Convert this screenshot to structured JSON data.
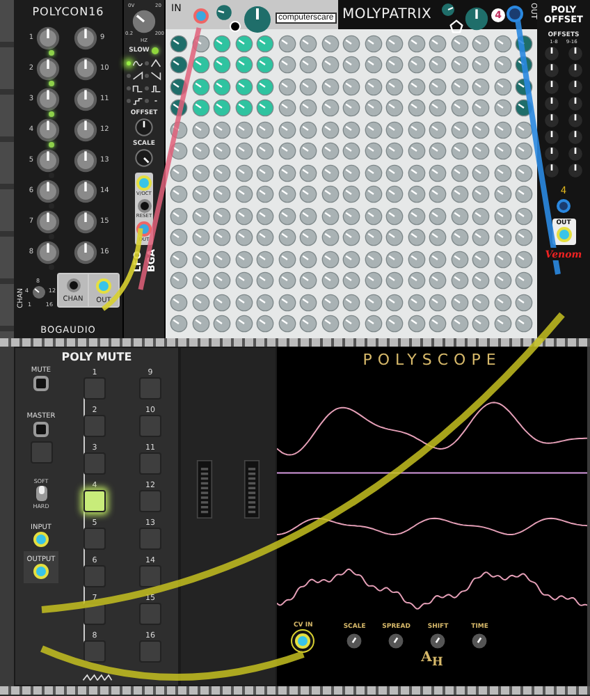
{
  "polycon16": {
    "title": "POLYCON16",
    "knobs": [
      {
        "label": "1",
        "lit": true
      },
      {
        "label": "2",
        "lit": true
      },
      {
        "label": "3",
        "lit": true
      },
      {
        "label": "4",
        "lit": true
      },
      {
        "label": "5",
        "lit": false
      },
      {
        "label": "6",
        "lit": false
      },
      {
        "label": "7",
        "lit": false
      },
      {
        "label": "8",
        "lit": false
      },
      {
        "label": "9"
      },
      {
        "label": "10"
      },
      {
        "label": "11"
      },
      {
        "label": "12"
      },
      {
        "label": "13"
      },
      {
        "label": "14"
      },
      {
        "label": "15"
      },
      {
        "label": "16"
      }
    ],
    "chan_label": "CHAN",
    "chan_scale": [
      "8",
      "4",
      "12",
      "1",
      "16"
    ],
    "ports": [
      "CHAN",
      "OUT"
    ],
    "brand": "BOGAUDIO"
  },
  "lfo": {
    "range_labels": [
      "0V",
      "20",
      "0.2",
      "HZ",
      "200"
    ],
    "slow": {
      "label": "SLOW",
      "lit": true
    },
    "waves": [
      {
        "kind": "sine",
        "selected": true
      },
      {
        "kind": "triangle",
        "selected": false
      },
      {
        "kind": "ramp",
        "selected": false
      },
      {
        "kind": "saw",
        "selected": false
      },
      {
        "kind": "square",
        "selected": false
      },
      {
        "kind": "pulse",
        "selected": false
      },
      {
        "kind": "steps",
        "selected": false
      },
      {
        "kind": "dot",
        "selected": false
      }
    ],
    "offset_label": "OFFSET",
    "scale_label": "SCALE",
    "ports": [
      "V/OCT",
      "RESET",
      "OUT"
    ],
    "name": "LFO",
    "brand": "BGA"
  },
  "molypatrix": {
    "in_label": "IN",
    "logo": "computerscare",
    "title": "MOLYPATRIX",
    "badge": "4",
    "out_label": "OUT",
    "grid": [
      {
        "cells": [
          true,
          false,
          true,
          true,
          true,
          false,
          false,
          false,
          false,
          false,
          false,
          false,
          false,
          false,
          false,
          false,
          true
        ]
      },
      {
        "cells": [
          true,
          true,
          true,
          true,
          true,
          false,
          false,
          false,
          false,
          false,
          false,
          false,
          false,
          false,
          false,
          false,
          true
        ]
      },
      {
        "cells": [
          true,
          true,
          true,
          true,
          true,
          false,
          false,
          false,
          false,
          false,
          false,
          false,
          false,
          false,
          false,
          false,
          true
        ]
      },
      {
        "cells": [
          true,
          true,
          true,
          true,
          true,
          false,
          false,
          false,
          false,
          false,
          false,
          false,
          false,
          false,
          false,
          false,
          true
        ]
      },
      {
        "cells": [
          false,
          false,
          false,
          false,
          false,
          false,
          false,
          false,
          false,
          false,
          false,
          false,
          false,
          false,
          false,
          false,
          false
        ]
      },
      {
        "cells": [
          false,
          false,
          false,
          false,
          false,
          false,
          false,
          false,
          false,
          false,
          false,
          false,
          false,
          false,
          false,
          false,
          false
        ]
      },
      {
        "cells": [
          false,
          false,
          false,
          false,
          false,
          false,
          false,
          false,
          false,
          false,
          false,
          false,
          false,
          false,
          false,
          false,
          false
        ]
      },
      {
        "cells": [
          false,
          false,
          false,
          false,
          false,
          false,
          false,
          false,
          false,
          false,
          false,
          false,
          false,
          false,
          false,
          false,
          false
        ]
      },
      {
        "cells": [
          false,
          false,
          false,
          false,
          false,
          false,
          false,
          false,
          false,
          false,
          false,
          false,
          false,
          false,
          false,
          false,
          false
        ]
      },
      {
        "cells": [
          false,
          false,
          false,
          false,
          false,
          false,
          false,
          false,
          false,
          false,
          false,
          false,
          false,
          false,
          false,
          false,
          false
        ]
      },
      {
        "cells": [
          false,
          false,
          false,
          false,
          false,
          false,
          false,
          false,
          false,
          false,
          false,
          false,
          false,
          false,
          false,
          false,
          false
        ]
      },
      {
        "cells": [
          false,
          false,
          false,
          false,
          false,
          false,
          false,
          false,
          false,
          false,
          false,
          false,
          false,
          false,
          false,
          false,
          false
        ]
      },
      {
        "cells": [
          false,
          false,
          false,
          false,
          false,
          false,
          false,
          false,
          false,
          false,
          false,
          false,
          false,
          false,
          false,
          false,
          false
        ]
      },
      {
        "cells": [
          false,
          false,
          false,
          false,
          false,
          false,
          false,
          false,
          false,
          false,
          false,
          false,
          false,
          false,
          false,
          false,
          false
        ]
      }
    ]
  },
  "poly_offset": {
    "title": "POLY OFFSET",
    "offsets_label": "OFFSETS",
    "column_labels": [
      "1-8",
      "9-16"
    ],
    "display": "4",
    "out_label": "OUT",
    "brand": "Venom"
  },
  "poly_mute": {
    "title": "POLY MUTE",
    "mute_label": "MUTE",
    "master_label": "MASTER",
    "master_on": false,
    "switch": {
      "top": "SOFT",
      "bottom": "HARD",
      "up": true
    },
    "input_label": "INPUT",
    "output_label": "OUTPUT",
    "buttons": [
      {
        "label": "1",
        "on": false
      },
      {
        "label": "2",
        "on": false
      },
      {
        "label": "3",
        "on": false
      },
      {
        "label": "4",
        "on": true
      },
      {
        "label": "5",
        "on": false
      },
      {
        "label": "6",
        "on": false
      },
      {
        "label": "7",
        "on": false
      },
      {
        "label": "8",
        "on": false
      },
      {
        "label": "9",
        "on": false
      },
      {
        "label": "10",
        "on": false
      },
      {
        "label": "11",
        "on": false
      },
      {
        "label": "12",
        "on": false
      },
      {
        "label": "13",
        "on": false
      },
      {
        "label": "14",
        "on": false
      },
      {
        "label": "15",
        "on": false
      },
      {
        "label": "16",
        "on": false
      }
    ]
  },
  "polyscope": {
    "title": "POLYSCOPE",
    "cv_label": "CV IN",
    "knobs": [
      {
        "label": "SCALE"
      },
      {
        "label": "SPREAD"
      },
      {
        "label": "SHIFT"
      },
      {
        "label": "TIME"
      }
    ],
    "logo": "A$_{H}$"
  }
}
